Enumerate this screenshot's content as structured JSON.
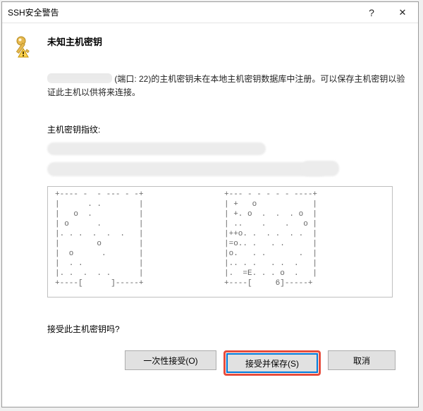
{
  "titlebar": {
    "title": "SSH安全警告",
    "help": "?",
    "close": "✕"
  },
  "heading": "未知主机密钥",
  "description_prefix": " (端口: 22)的主机密钥未在本地主机密钥数据库中注册。可以保存主机密钥以验证此主机以供将来连接。",
  "port": 22,
  "fingerprint_label": "主机密钥指纹:",
  "ascii_left": "+---- -  - --- - -+\n|      . .        |\n|   o  .          |\n| o      .        |\n|. . .  .  .  .   |\n|        o        |\n|  o      .       |\n|  . .            |\n|. .  .  . .      |\n+----[      ]-----+",
  "ascii_right": "+--- - - - - - ----+\n| +   o            |\n| +. o  .  .  . o  |\n| ..    .    .   o |\n|++o. .  . .  . .  |\n|=o.. .   . .      |\n|o.   . .       .  |\n|.. . .   . .  .   |\n|.  =E. . . o  .   |\n+----[     6]-----+",
  "question_text": "接受此主机密钥吗?",
  "buttons": {
    "once": "一次性接受(O)",
    "accept_save": "接受并保存(S)",
    "cancel": "取消"
  }
}
